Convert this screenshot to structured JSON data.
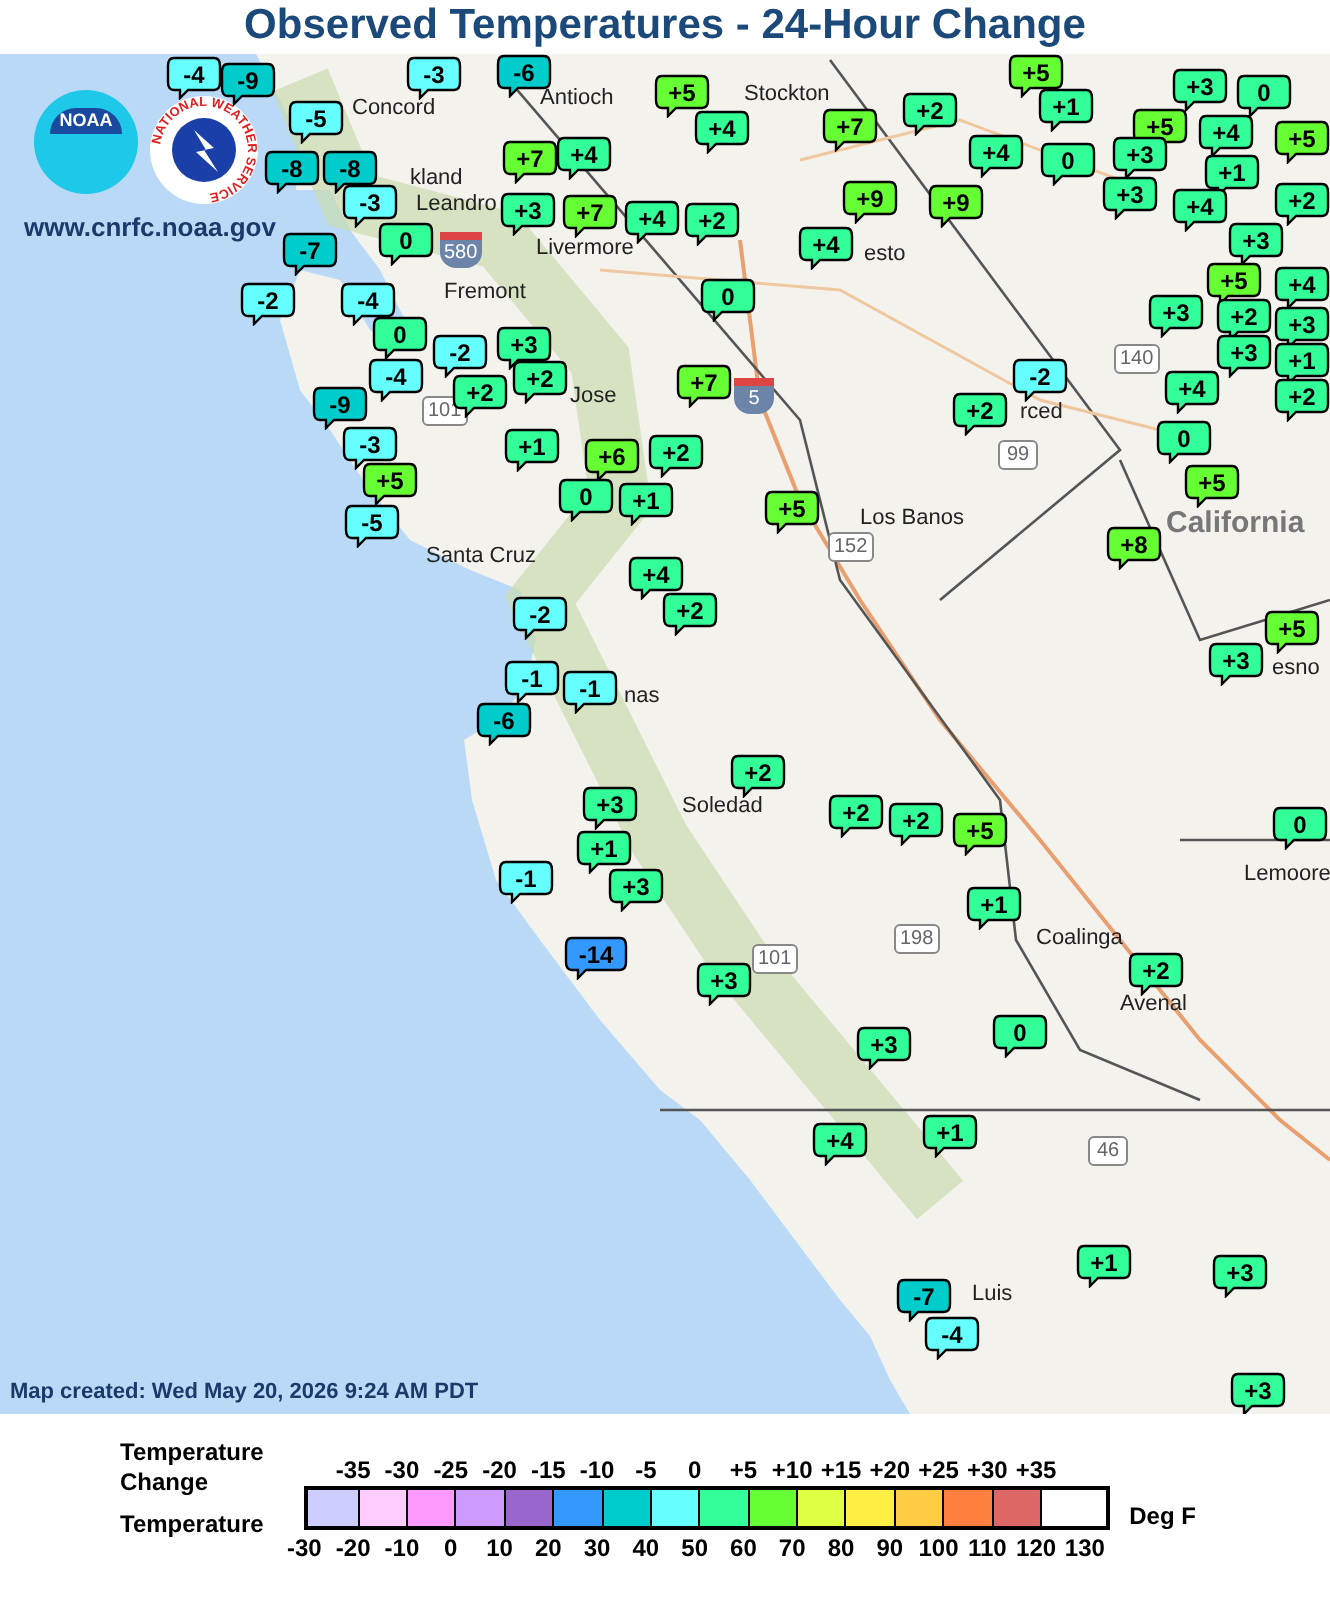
{
  "title": "Observed Temperatures - 24-Hour Change",
  "logos": {
    "noaa": "NOAA",
    "nws": "NATIONAL WEATHER SERVICE",
    "website": "www.cnrfc.noaa.gov"
  },
  "places": [
    {
      "name": "Concord"
    },
    {
      "name": "Antioch"
    },
    {
      "name": "Stockton"
    },
    {
      "name": "kland"
    },
    {
      "name": "Leandro"
    },
    {
      "name": "Livermore"
    },
    {
      "name": "Fremont"
    },
    {
      "name": "Jose"
    },
    {
      "name": "esto"
    },
    {
      "name": "rced"
    },
    {
      "name": "Los Banos"
    },
    {
      "name": "California",
      "kind": "state"
    },
    {
      "name": "Santa Cruz"
    },
    {
      "name": "nas"
    },
    {
      "name": "Soledad"
    },
    {
      "name": "Coalinga"
    },
    {
      "name": "Avenal"
    },
    {
      "name": "esno"
    },
    {
      "name": "Lemoore"
    },
    {
      "name": "Luis"
    }
  ],
  "highways": [
    {
      "number": "5",
      "kind": "interstate"
    },
    {
      "number": "580",
      "kind": "interstate"
    },
    {
      "number": "99",
      "kind": "state"
    },
    {
      "number": "140",
      "kind": "state"
    },
    {
      "number": "152",
      "kind": "state"
    },
    {
      "number": "101",
      "kind": "us"
    },
    {
      "number": "101",
      "kind": "us"
    },
    {
      "number": "198",
      "kind": "state"
    },
    {
      "number": "46",
      "kind": "state"
    }
  ],
  "markers": [
    {
      "value": "-4",
      "color": "#66ffff"
    },
    {
      "value": "-9",
      "color": "#00cccc"
    },
    {
      "value": "-3",
      "color": "#66ffff"
    },
    {
      "value": "-6",
      "color": "#00cccc"
    },
    {
      "value": "+5",
      "color": "#66ff33"
    },
    {
      "value": "+5",
      "color": "#66ff33"
    },
    {
      "value": "+3",
      "color": "#33ff99"
    },
    {
      "value": "0",
      "color": "#33ff99"
    },
    {
      "value": "-5",
      "color": "#66ffff"
    },
    {
      "value": "+4",
      "color": "#33ff99"
    },
    {
      "value": "+7",
      "color": "#66ff33"
    },
    {
      "value": "+2",
      "color": "#33ff99"
    },
    {
      "value": "+1",
      "color": "#33ff99"
    },
    {
      "value": "+5",
      "color": "#66ff33"
    },
    {
      "value": "+4",
      "color": "#33ff99"
    },
    {
      "value": "+5",
      "color": "#66ff33"
    },
    {
      "value": "-8",
      "color": "#00cccc"
    },
    {
      "value": "-8",
      "color": "#00cccc"
    },
    {
      "value": "+7",
      "color": "#66ff33"
    },
    {
      "value": "+4",
      "color": "#33ff99"
    },
    {
      "value": "+4",
      "color": "#33ff99"
    },
    {
      "value": "0",
      "color": "#33ff99"
    },
    {
      "value": "+3",
      "color": "#33ff99"
    },
    {
      "value": "+1",
      "color": "#33ff99"
    },
    {
      "value": "-3",
      "color": "#66ffff"
    },
    {
      "value": "+3",
      "color": "#33ff99"
    },
    {
      "value": "+7",
      "color": "#66ff33"
    },
    {
      "value": "+4",
      "color": "#33ff99"
    },
    {
      "value": "+2",
      "color": "#33ff99"
    },
    {
      "value": "+9",
      "color": "#66ff33"
    },
    {
      "value": "+9",
      "color": "#66ff33"
    },
    {
      "value": "+3",
      "color": "#33ff99"
    },
    {
      "value": "+4",
      "color": "#33ff99"
    },
    {
      "value": "+2",
      "color": "#33ff99"
    },
    {
      "value": "-7",
      "color": "#00cccc"
    },
    {
      "value": "0",
      "color": "#33ff99"
    },
    {
      "value": "+4",
      "color": "#33ff99"
    },
    {
      "value": "+3",
      "color": "#33ff99"
    },
    {
      "value": "-2",
      "color": "#66ffff"
    },
    {
      "value": "-4",
      "color": "#66ffff"
    },
    {
      "value": "0",
      "color": "#33ff99"
    },
    {
      "value": "+5",
      "color": "#66ff33"
    },
    {
      "value": "+4",
      "color": "#33ff99"
    },
    {
      "value": "0",
      "color": "#33ff99"
    },
    {
      "value": "-2",
      "color": "#66ffff"
    },
    {
      "value": "+3",
      "color": "#33ff99"
    },
    {
      "value": "+3",
      "color": "#33ff99"
    },
    {
      "value": "+2",
      "color": "#33ff99"
    },
    {
      "value": "+3",
      "color": "#33ff99"
    },
    {
      "value": "+3",
      "color": "#33ff99"
    },
    {
      "value": "-9",
      "color": "#00cccc"
    },
    {
      "value": "-4",
      "color": "#66ffff"
    },
    {
      "value": "+2",
      "color": "#33ff99"
    },
    {
      "value": "+2",
      "color": "#33ff99"
    },
    {
      "value": "+7",
      "color": "#66ff33"
    },
    {
      "value": "+2",
      "color": "#33ff99"
    },
    {
      "value": "-2",
      "color": "#66ffff"
    },
    {
      "value": "+4",
      "color": "#33ff99"
    },
    {
      "value": "+1",
      "color": "#33ff99"
    },
    {
      "value": "+2",
      "color": "#33ff99"
    },
    {
      "value": "-3",
      "color": "#66ffff"
    },
    {
      "value": "+1",
      "color": "#33ff99"
    },
    {
      "value": "+6",
      "color": "#66ff33"
    },
    {
      "value": "+2",
      "color": "#33ff99"
    },
    {
      "value": "0",
      "color": "#33ff99"
    },
    {
      "value": "+5",
      "color": "#66ff33"
    },
    {
      "value": "0",
      "color": "#33ff99"
    },
    {
      "value": "+1",
      "color": "#33ff99"
    },
    {
      "value": "+5",
      "color": "#66ff33"
    },
    {
      "value": "+5",
      "color": "#66ff33"
    },
    {
      "value": "-5",
      "color": "#66ffff"
    },
    {
      "value": "+8",
      "color": "#66ff33"
    },
    {
      "value": "+4",
      "color": "#33ff99"
    },
    {
      "value": "-2",
      "color": "#66ffff"
    },
    {
      "value": "+2",
      "color": "#33ff99"
    },
    {
      "value": "+5",
      "color": "#66ff33"
    },
    {
      "value": "+3",
      "color": "#33ff99"
    },
    {
      "value": "-1",
      "color": "#66ffff"
    },
    {
      "value": "-1",
      "color": "#66ffff"
    },
    {
      "value": "-6",
      "color": "#00cccc"
    },
    {
      "value": "+2",
      "color": "#33ff99"
    },
    {
      "value": "+3",
      "color": "#33ff99"
    },
    {
      "value": "+2",
      "color": "#33ff99"
    },
    {
      "value": "+2",
      "color": "#33ff99"
    },
    {
      "value": "+5",
      "color": "#66ff33"
    },
    {
      "value": "0",
      "color": "#33ff99"
    },
    {
      "value": "+1",
      "color": "#33ff99"
    },
    {
      "value": "-1",
      "color": "#66ffff"
    },
    {
      "value": "+3",
      "color": "#33ff99"
    },
    {
      "value": "+1",
      "color": "#33ff99"
    },
    {
      "value": "-14",
      "color": "#3399ff"
    },
    {
      "value": "+3",
      "color": "#33ff99"
    },
    {
      "value": "+2",
      "color": "#33ff99"
    },
    {
      "value": "+3",
      "color": "#33ff99"
    },
    {
      "value": "0",
      "color": "#33ff99"
    },
    {
      "value": "+4",
      "color": "#33ff99"
    },
    {
      "value": "+1",
      "color": "#33ff99"
    },
    {
      "value": "+1",
      "color": "#33ff99"
    },
    {
      "value": "+3",
      "color": "#33ff99"
    },
    {
      "value": "-7",
      "color": "#00cccc"
    },
    {
      "value": "-4",
      "color": "#66ffff"
    },
    {
      "value": "+3",
      "color": "#33ff99"
    }
  ],
  "map_created": "Map created: Wed May 20, 2026 9:24 AM PDT",
  "legend": {
    "change_label": "Temperature Change",
    "temperature_label": "Temperature",
    "unit": "Deg F",
    "change_ticks": [
      "-35",
      "-30",
      "-25",
      "-20",
      "-15",
      "-10",
      "-5",
      "0",
      "+5",
      "+10",
      "+15",
      "+20",
      "+25",
      "+30",
      "+35"
    ],
    "temperature_ticks": [
      "-30",
      "-20",
      "-10",
      "0",
      "10",
      "20",
      "30",
      "40",
      "50",
      "60",
      "70",
      "80",
      "90",
      "100",
      "110",
      "120",
      "130"
    ],
    "swatches": [
      {
        "color": "#ccccff"
      },
      {
        "color": "#ffccff"
      },
      {
        "color": "#ff99ff"
      },
      {
        "color": "#cc99ff"
      },
      {
        "color": "#9966cc"
      },
      {
        "color": "#3399ff"
      },
      {
        "color": "#00cccc"
      },
      {
        "color": "#66ffff"
      },
      {
        "color": "#33ff99"
      },
      {
        "color": "#66ff33"
      },
      {
        "color": "#ddff44"
      },
      {
        "color": "#ffee44"
      },
      {
        "color": "#ffcc44"
      },
      {
        "color": "#ff7f3f"
      },
      {
        "color": "#dd6666"
      },
      {
        "color": "#ffffff"
      }
    ]
  }
}
